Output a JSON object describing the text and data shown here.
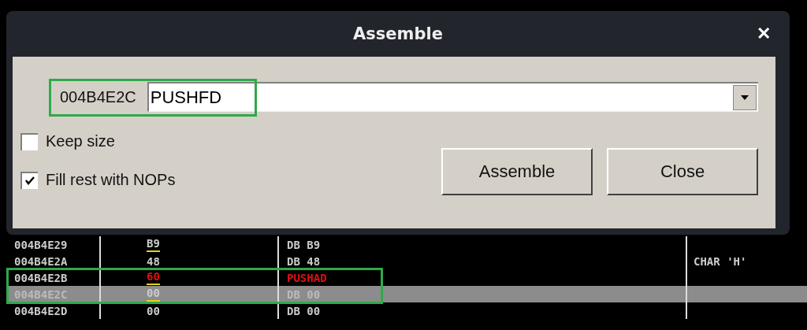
{
  "dialog": {
    "title": "Assemble",
    "close": "✕",
    "address": "004B4E2C",
    "command": {
      "value": "PUSHFD"
    },
    "options": [
      {
        "label": "Keep size",
        "checked": false
      },
      {
        "label": "Fill rest with NOPs",
        "checked": true
      }
    ],
    "buttons": [
      "Assemble",
      "Close"
    ]
  },
  "listing": {
    "rows": [
      {
        "address": "004B4E29",
        "hex": "B9",
        "disasm": "DB B9",
        "comment": "",
        "changed": true,
        "modified": false,
        "selected": false
      },
      {
        "address": "004B4E2A",
        "hex": "48",
        "disasm": "DB 48",
        "comment": "CHAR 'H'",
        "changed": false,
        "modified": false,
        "selected": false
      },
      {
        "address": "004B4E2B",
        "hex": "60",
        "disasm": "PUSHAD",
        "comment": "",
        "changed": true,
        "modified": true,
        "selected": false
      },
      {
        "address": "004B4E2C",
        "hex": "00",
        "disasm": "DB 00",
        "comment": "",
        "changed": true,
        "modified": false,
        "selected": true
      },
      {
        "address": "004B4E2D",
        "hex": "00",
        "disasm": "DB 00",
        "comment": "",
        "changed": false,
        "modified": false,
        "selected": false
      }
    ]
  }
}
